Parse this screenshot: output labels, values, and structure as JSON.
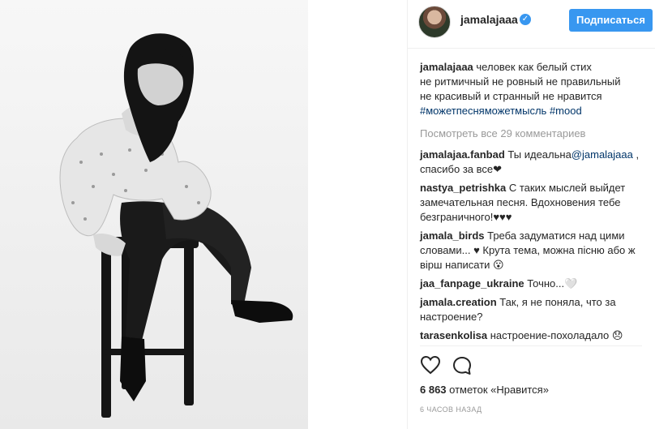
{
  "post": {
    "username": "jamalajaaa",
    "verified_mark": "✓",
    "subscribe_label": "Подписаться",
    "caption": {
      "user": "jamalajaaa",
      "line1": " человек как белый стих",
      "line2": "не ритмичный не ровный не правильный",
      "line3": "не красивый и странный не нравится",
      "hashtag1": "#можетпесняможетмысль",
      "hashtag2": "#mood"
    },
    "view_all_label": "Посмотреть все 29 комментариев",
    "comments": [
      {
        "user": "jamalajaa.fanbad",
        "text_before": " Ты идеальна",
        "mention": "@jamalajaaa",
        "text_after": " , спасибо за все❤"
      },
      {
        "user": "nastya_petrishka",
        "text": " С таких мыслей выйдет замечательная песня. Вдохновения тебе безграничного!♥♥♥"
      },
      {
        "user": "jamala_birds",
        "text": " Треба задуматися над цими словами... ♥ Крута тема, можна пісню або ж вірш написати 😮"
      },
      {
        "user": "jaa_fanpage_ukraine",
        "text": " Точно...🤍"
      },
      {
        "user": "jamala.creation",
        "text": " Так, я не поняла, что за настроение?"
      },
      {
        "user": "tarasenkolisa",
        "text": " настроение-похоладало 😞"
      }
    ],
    "likes_count": "6 863",
    "likes_label": " отметок «Нравится»",
    "time_ago": "6 часов назад"
  },
  "colors": {
    "accent": "#3897f0",
    "link": "#003569",
    "muted": "#999999",
    "text": "#262626"
  },
  "icons": [
    "verified-badge-icon",
    "heart-icon",
    "comment-bubble-icon"
  ]
}
